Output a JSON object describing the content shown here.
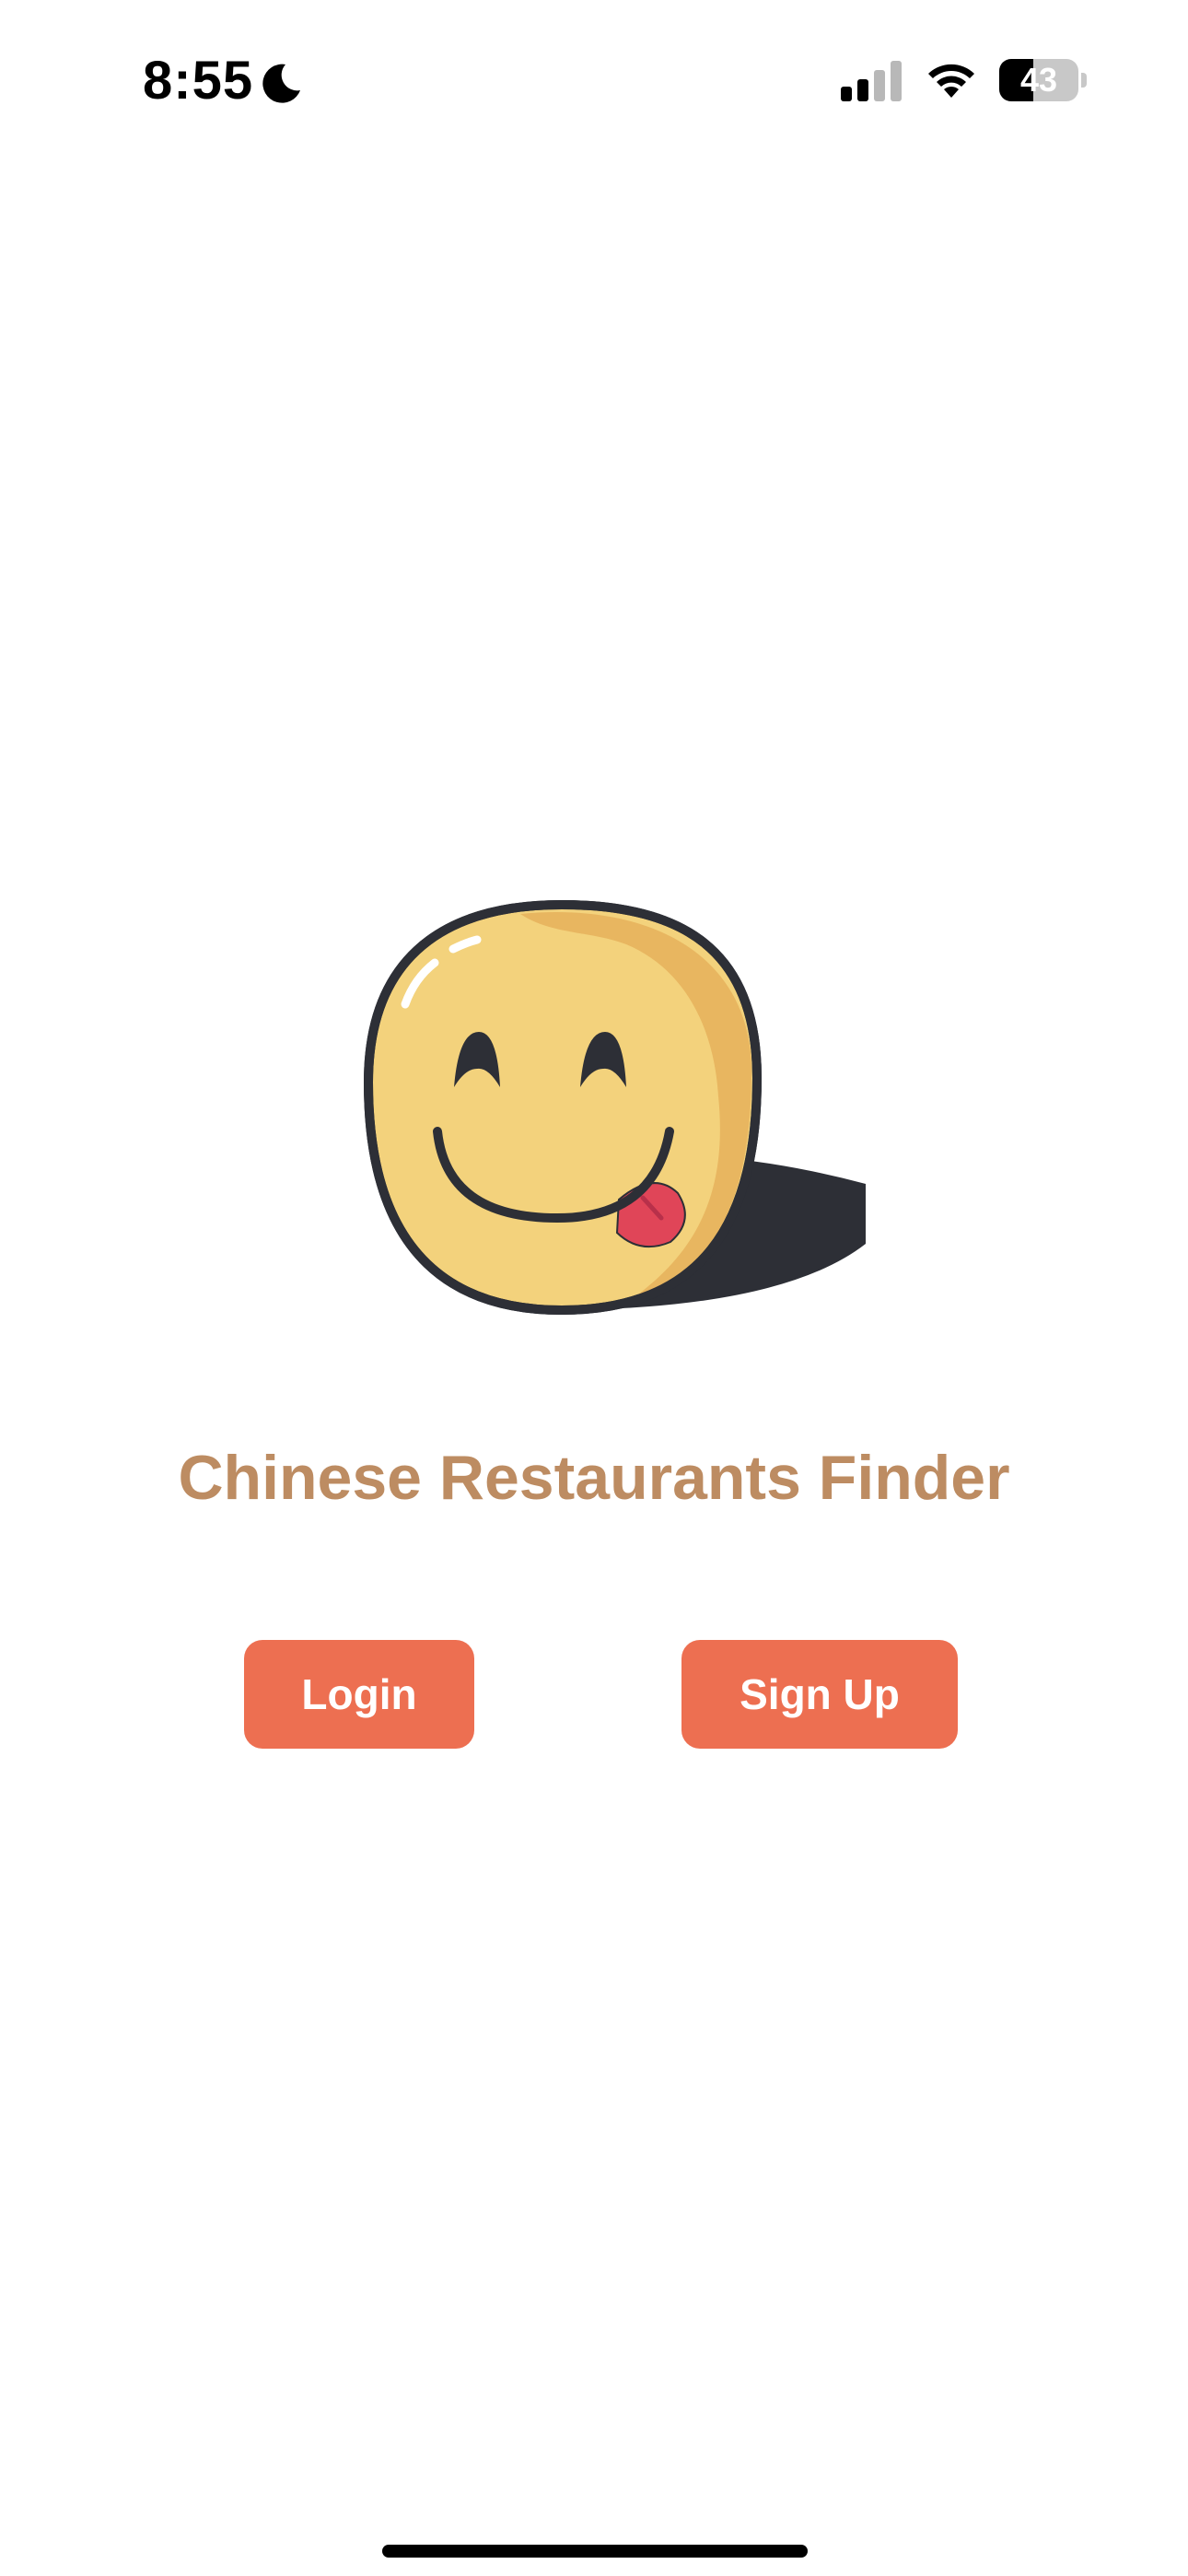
{
  "status_bar": {
    "time": "8:55",
    "battery_level": "43",
    "battery_fraction": 0.43,
    "icons": [
      "moon-icon",
      "cellular-signal-icon",
      "wifi-icon",
      "battery-icon"
    ]
  },
  "main": {
    "logo_icon": "smiling-bun-face-icon",
    "title": "Chinese Restaurants Finder",
    "login_label": "Login",
    "signup_label": "Sign Up"
  },
  "colors": {
    "title": "#bd8c62",
    "button_bg": "#ed6f51",
    "button_text": "#ffffff",
    "face_fill": "#f3d27c",
    "face_shade": "#e8b660",
    "outline": "#2d2f36",
    "tongue": "#e04558"
  }
}
